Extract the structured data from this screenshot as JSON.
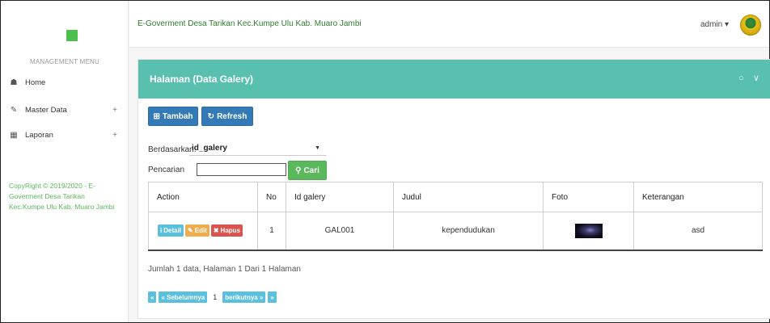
{
  "header": {
    "app_title": "E-Goverment Desa Tarikan Kec.Kumpe Ulu Kab. Muaro Jambi",
    "user_label": "admin ▾"
  },
  "sidebar": {
    "menu_header": "MANAGEMENT MENU",
    "items": [
      {
        "label": "Home",
        "icon": "home-icon"
      },
      {
        "label": "Master Data",
        "icon": "edit-icon",
        "expand": "+"
      },
      {
        "label": "Laporan",
        "icon": "calendar-icon",
        "expand": "+"
      }
    ],
    "copyright": "CopyRight © 2019/2020 - E-Goverment Desa Tarikan Kec.Kumpe Ulu Kab. Muaro Jambi"
  },
  "panel": {
    "title": "Halaman (Data Galery)",
    "tools": "○ ∨"
  },
  "toolbar": {
    "add_label": "Tambah",
    "refresh_label": "Refresh"
  },
  "filter": {
    "by_label": "Berdasarkan:",
    "by_value": "id_galery",
    "search_label": "Pencarian",
    "search_value": "",
    "search_button": "Cari"
  },
  "table": {
    "columns": [
      "Action",
      "No",
      "Id galery",
      "Judul",
      "Foto",
      "Keterangan"
    ],
    "rows": [
      {
        "no": "1",
        "id": "GAL001",
        "judul": "kependudukan",
        "keterangan": "asd",
        "actions": {
          "detail": "Detail",
          "edit": "Edit",
          "delete": "Hapus"
        }
      }
    ]
  },
  "footer": {
    "info": "Jumlah 1 data, Halaman 1 Dari 1 Halaman",
    "pager": {
      "first": "«",
      "prev": "« Sebelumnya",
      "current": "1",
      "next": "berikutnya »",
      "last": "»"
    }
  },
  "colors": {
    "panel_header": "#59c0b0",
    "primary": "#337ab7",
    "success": "#5cb85c",
    "info": "#5bc0de",
    "warning": "#f0ad4e",
    "danger": "#d9534f"
  }
}
